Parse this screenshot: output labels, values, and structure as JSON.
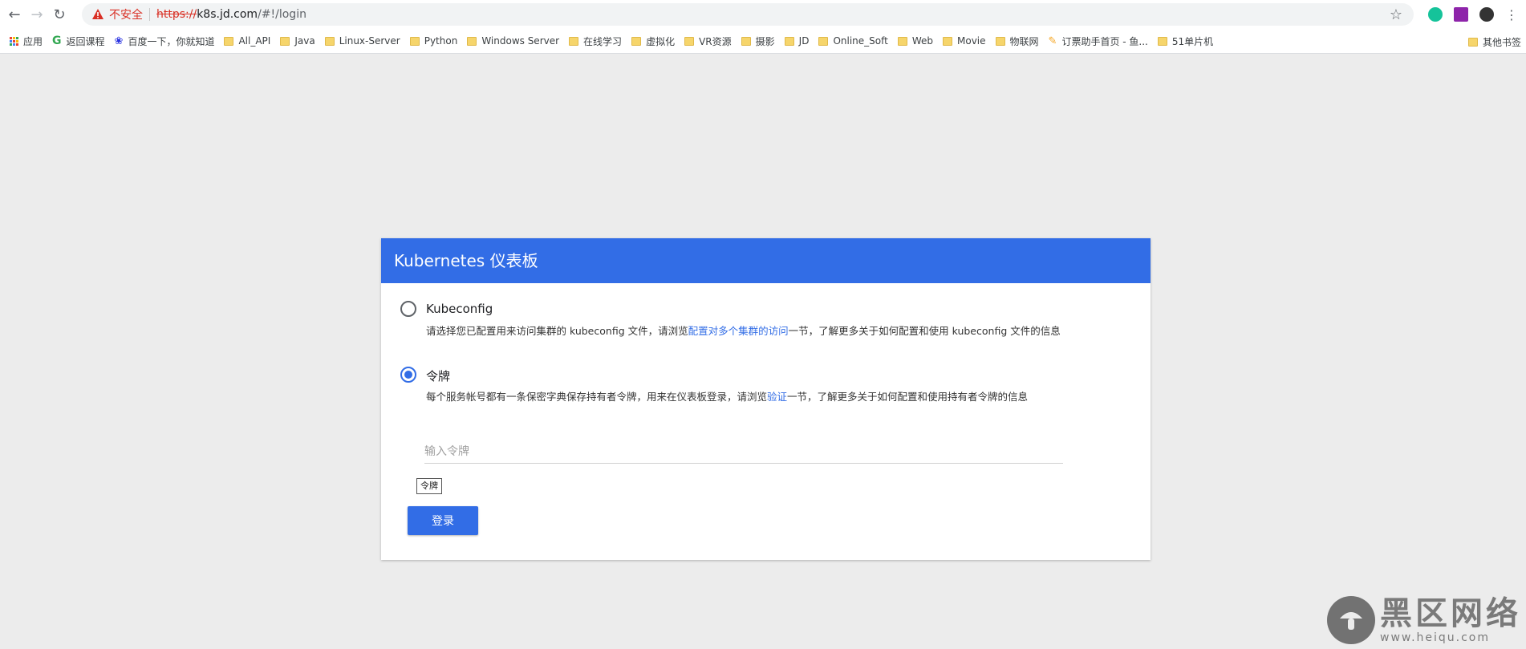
{
  "browser": {
    "insecure_label": "不安全",
    "url_scheme": "https://",
    "url_host": "k8s.jd.com",
    "url_path": "/#!/login"
  },
  "bookmarks": {
    "items": [
      {
        "label": "应用",
        "icon": "apps-grid-icon"
      },
      {
        "label": "返回课程",
        "icon": "grammarly-icon"
      },
      {
        "label": "百度一下，你就知道",
        "icon": "baidu-icon"
      },
      {
        "label": "All_API",
        "icon": "folder-icon"
      },
      {
        "label": "Java",
        "icon": "folder-icon"
      },
      {
        "label": "Linux-Server",
        "icon": "folder-icon"
      },
      {
        "label": "Python",
        "icon": "folder-icon"
      },
      {
        "label": "Windows Server",
        "icon": "folder-icon"
      },
      {
        "label": "在线学习",
        "icon": "folder-icon"
      },
      {
        "label": "虚拟化",
        "icon": "folder-icon"
      },
      {
        "label": "VR资源",
        "icon": "folder-icon"
      },
      {
        "label": "摄影",
        "icon": "folder-icon"
      },
      {
        "label": "JD",
        "icon": "folder-icon"
      },
      {
        "label": "Online_Soft",
        "icon": "folder-icon"
      },
      {
        "label": "Web",
        "icon": "folder-icon"
      },
      {
        "label": "Movie",
        "icon": "folder-icon"
      },
      {
        "label": "物联网",
        "icon": "folder-icon"
      },
      {
        "label": "订票助手首页 - 鱼...",
        "icon": "ticket-icon"
      },
      {
        "label": "51单片机",
        "icon": "folder-icon"
      }
    ],
    "more": "»",
    "other": "其他书签"
  },
  "card": {
    "title": "Kubernetes 仪表板",
    "kubeconfig_label": "Kubeconfig",
    "kubeconfig_desc_pre": "请选择您已配置用来访问集群的 kubeconfig 文件，请浏览",
    "kubeconfig_desc_link": "配置对多个集群的访问",
    "kubeconfig_desc_post": "一节，了解更多关于如何配置和使用 kubeconfig 文件的信息",
    "token_label": "令牌",
    "token_desc_pre": "每个服务帐号都有一条保密字典保存持有者令牌，用来在仪表板登录，请浏览",
    "token_desc_link": "验证",
    "token_desc_post": "一节，了解更多关于如何配置和使用持有者令牌的信息",
    "token_placeholder": "输入令牌",
    "tooltip": "令牌",
    "login_button": "登录",
    "selected": "token"
  },
  "colors": {
    "accent": "#326de6",
    "insecure": "#d93025"
  },
  "watermark": {
    "title": "黑区网络",
    "url": "www.heiqu.com"
  }
}
